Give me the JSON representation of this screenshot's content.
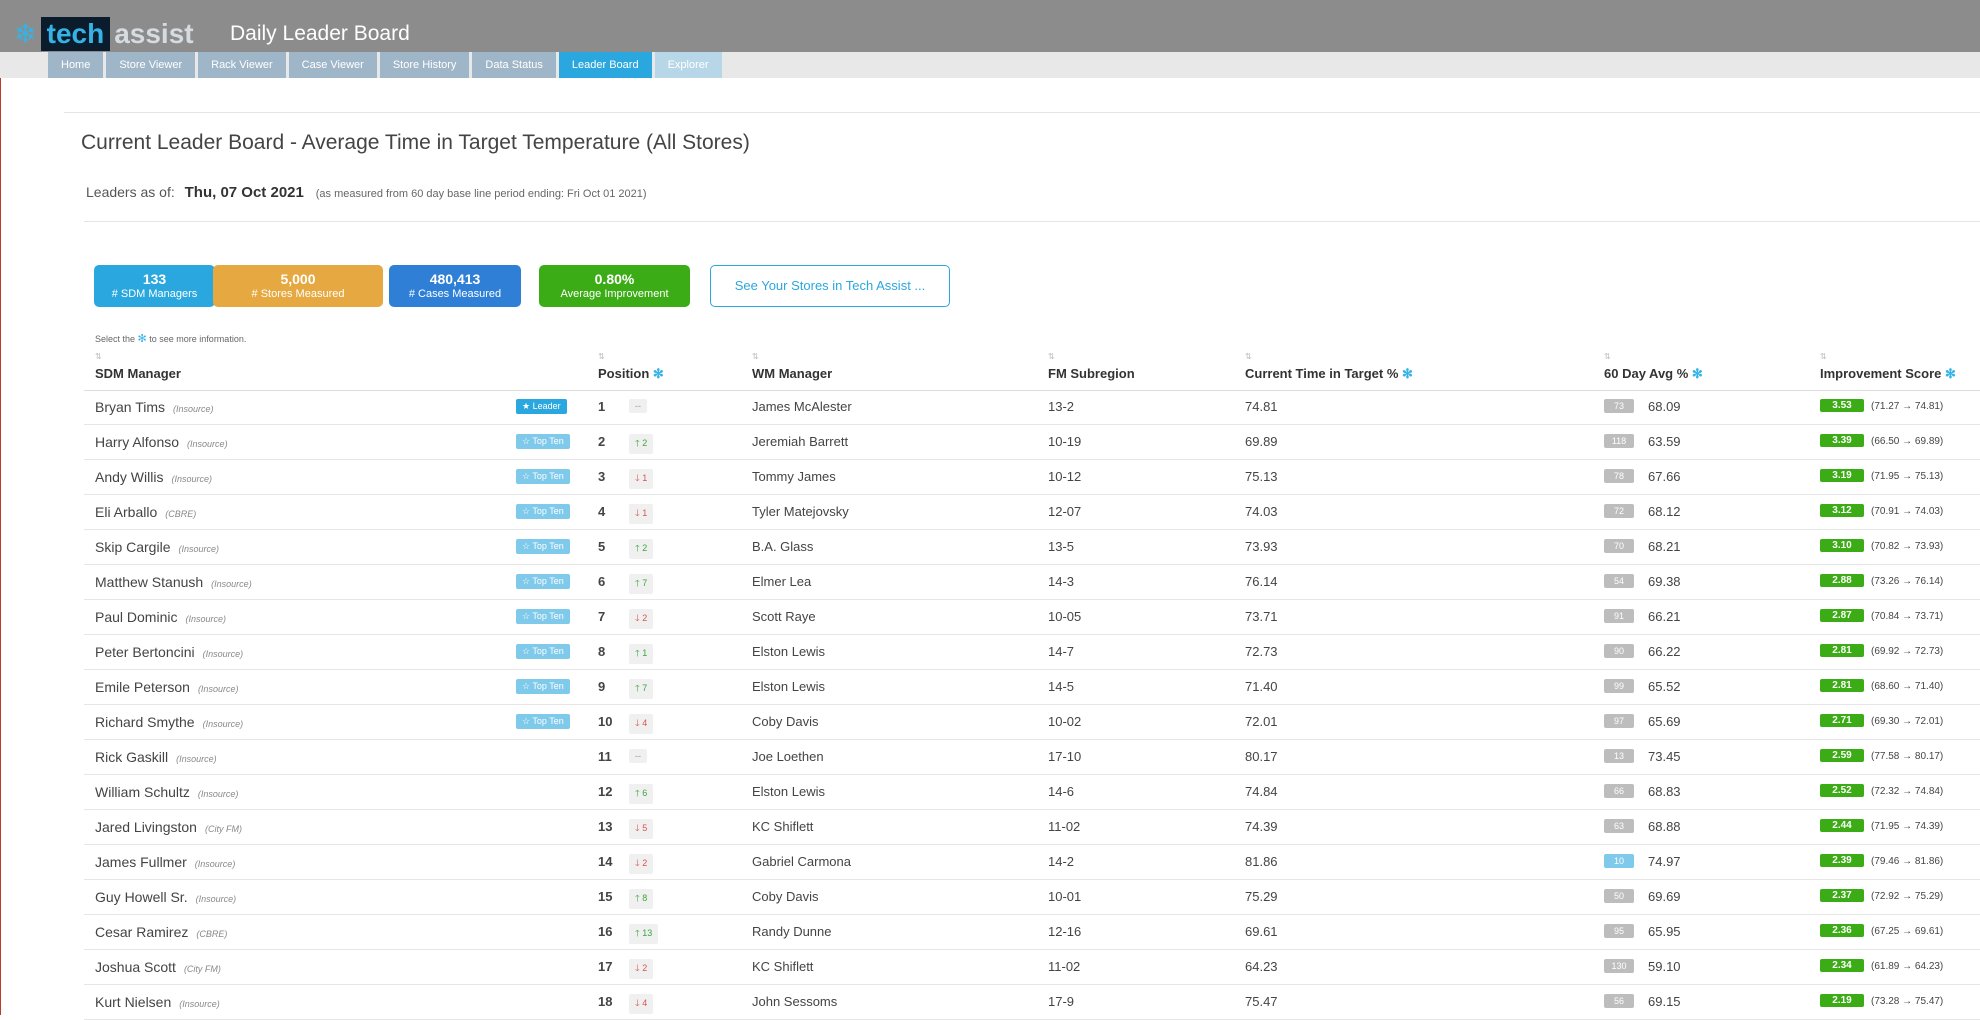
{
  "brand": {
    "tech": "tech",
    "assist": "assist"
  },
  "app_title": "Daily Leader Board",
  "tabs": [
    {
      "label": "Home"
    },
    {
      "label": "Store Viewer"
    },
    {
      "label": "Rack Viewer"
    },
    {
      "label": "Case Viewer"
    },
    {
      "label": "Store History"
    },
    {
      "label": "Data Status"
    },
    {
      "label": "Leader Board"
    },
    {
      "label": "Explorer"
    }
  ],
  "page_title": "Current Leader Board - Average Time in Target Temperature (All Stores)",
  "leaders": {
    "label": "Leaders as of:",
    "date": "Thu, 07 Oct 2021",
    "note": "(as measured from 60 day base line period ending: Fri Oct 01 2021)"
  },
  "stats": [
    {
      "value": "133",
      "label": "# SDM Managers",
      "color": "#2aa7de"
    },
    {
      "value": "5,000",
      "label": "# Stores Measured",
      "color": "#e6a840"
    },
    {
      "value": "480,413",
      "label": "# Cases Measured",
      "color": "#2f7fd6"
    },
    {
      "value": "0.80%",
      "label": "Average Improvement",
      "color": "#3cac16"
    }
  ],
  "see_button": "See Your Stores in Tech Assist ...",
  "hint": {
    "before": "Select the",
    "after": "to see more information."
  },
  "columns": {
    "sdm": "SDM Manager",
    "position": "Position",
    "wm": "WM Manager",
    "fm": "FM Subregion",
    "current": "Current Time in Target %",
    "avg": "60 Day Avg %",
    "score": "Improvement Score"
  },
  "rows": [
    {
      "name": "Bryan Tims",
      "company": "(Insource)",
      "badge": "Leader",
      "badge_type": "leader",
      "pos": "1",
      "chg": "--",
      "dir": "none",
      "wm": "James McAlester",
      "fm": "13-2",
      "current": "74.81",
      "days": "73",
      "avg": "68.09",
      "score": "3.53",
      "range": "(71.27 → 74.81)"
    },
    {
      "name": "Harry Alfonso",
      "company": "(Insource)",
      "badge": "Top Ten",
      "badge_type": "topten",
      "pos": "2",
      "chg": "2",
      "dir": "up",
      "wm": "Jeremiah Barrett",
      "fm": "10-19",
      "current": "69.89",
      "days": "118",
      "avg": "63.59",
      "score": "3.39",
      "range": "(66.50 → 69.89)"
    },
    {
      "name": "Andy Willis",
      "company": "(Insource)",
      "badge": "Top Ten",
      "badge_type": "topten",
      "pos": "3",
      "chg": "1",
      "dir": "down",
      "wm": "Tommy James",
      "fm": "10-12",
      "current": "75.13",
      "days": "78",
      "avg": "67.66",
      "score": "3.19",
      "range": "(71.95 → 75.13)"
    },
    {
      "name": "Eli Arballo",
      "company": "(CBRE)",
      "badge": "Top Ten",
      "badge_type": "topten",
      "pos": "4",
      "chg": "1",
      "dir": "down",
      "wm": "Tyler Matejovsky",
      "fm": "12-07",
      "current": "74.03",
      "days": "72",
      "avg": "68.12",
      "score": "3.12",
      "range": "(70.91 → 74.03)"
    },
    {
      "name": "Skip Cargile",
      "company": "(Insource)",
      "badge": "Top Ten",
      "badge_type": "topten",
      "pos": "5",
      "chg": "2",
      "dir": "up",
      "wm": "B.A. Glass",
      "fm": "13-5",
      "current": "73.93",
      "days": "70",
      "avg": "68.21",
      "score": "3.10",
      "range": "(70.82 → 73.93)"
    },
    {
      "name": "Matthew Stanush",
      "company": "(Insource)",
      "badge": "Top Ten",
      "badge_type": "topten",
      "pos": "6",
      "chg": "7",
      "dir": "up",
      "wm": "Elmer Lea",
      "fm": "14-3",
      "current": "76.14",
      "days": "54",
      "avg": "69.38",
      "score": "2.88",
      "range": "(73.26 → 76.14)"
    },
    {
      "name": "Paul Dominic",
      "company": "(Insource)",
      "badge": "Top Ten",
      "badge_type": "topten",
      "pos": "7",
      "chg": "2",
      "dir": "down",
      "wm": "Scott Raye",
      "fm": "10-05",
      "current": "73.71",
      "days": "91",
      "avg": "66.21",
      "score": "2.87",
      "range": "(70.84 → 73.71)"
    },
    {
      "name": "Peter Bertoncini",
      "company": "(Insource)",
      "badge": "Top Ten",
      "badge_type": "topten",
      "pos": "8",
      "chg": "1",
      "dir": "up",
      "wm": "Elston Lewis",
      "fm": "14-7",
      "current": "72.73",
      "days": "90",
      "avg": "66.22",
      "score": "2.81",
      "range": "(69.92 → 72.73)"
    },
    {
      "name": "Emile Peterson",
      "company": "(Insource)",
      "badge": "Top Ten",
      "badge_type": "topten",
      "pos": "9",
      "chg": "7",
      "dir": "up",
      "wm": "Elston Lewis",
      "fm": "14-5",
      "current": "71.40",
      "days": "99",
      "avg": "65.52",
      "score": "2.81",
      "range": "(68.60 → 71.40)"
    },
    {
      "name": "Richard Smythe",
      "company": "(Insource)",
      "badge": "Top Ten",
      "badge_type": "topten",
      "pos": "10",
      "chg": "4",
      "dir": "down",
      "wm": "Coby Davis",
      "fm": "10-02",
      "current": "72.01",
      "days": "97",
      "avg": "65.69",
      "score": "2.71",
      "range": "(69.30 → 72.01)"
    },
    {
      "name": "Rick Gaskill",
      "company": "(Insource)",
      "badge": "",
      "badge_type": "",
      "pos": "11",
      "chg": "--",
      "dir": "none",
      "wm": "Joe Loethen",
      "fm": "17-10",
      "current": "80.17",
      "days": "13",
      "avg": "73.45",
      "score": "2.59",
      "range": "(77.58 → 80.17)"
    },
    {
      "name": "William Schultz",
      "company": "(Insource)",
      "badge": "",
      "badge_type": "",
      "pos": "12",
      "chg": "6",
      "dir": "up",
      "wm": "Elston Lewis",
      "fm": "14-6",
      "current": "74.84",
      "days": "66",
      "avg": "68.83",
      "score": "2.52",
      "range": "(72.32 → 74.84)"
    },
    {
      "name": "Jared Livingston",
      "company": "(City FM)",
      "badge": "",
      "badge_type": "",
      "pos": "13",
      "chg": "5",
      "dir": "down",
      "wm": "KC Shiflett",
      "fm": "11-02",
      "current": "74.39",
      "days": "63",
      "avg": "68.88",
      "score": "2.44",
      "range": "(71.95 → 74.39)"
    },
    {
      "name": "James Fullmer",
      "company": "(Insource)",
      "badge": "",
      "badge_type": "",
      "pos": "14",
      "chg": "2",
      "dir": "down",
      "wm": "Gabriel Carmona",
      "fm": "14-2",
      "current": "81.86",
      "days": "10",
      "avg": "74.97",
      "score": "2.39",
      "range": "(79.46 → 81.86)"
    },
    {
      "name": "Guy Howell Sr.",
      "company": "(Insource)",
      "badge": "",
      "badge_type": "",
      "pos": "15",
      "chg": "8",
      "dir": "up",
      "wm": "Coby Davis",
      "fm": "10-01",
      "current": "75.29",
      "days": "50",
      "avg": "69.69",
      "score": "2.37",
      "range": "(72.92 → 75.29)"
    },
    {
      "name": "Cesar Ramirez",
      "company": "(CBRE)",
      "badge": "",
      "badge_type": "",
      "pos": "16",
      "chg": "13",
      "dir": "up",
      "wm": "Randy Dunne",
      "fm": "12-16",
      "current": "69.61",
      "days": "95",
      "avg": "65.95",
      "score": "2.36",
      "range": "(67.25 → 69.61)"
    },
    {
      "name": "Joshua Scott",
      "company": "(City FM)",
      "badge": "",
      "badge_type": "",
      "pos": "17",
      "chg": "2",
      "dir": "down",
      "wm": "KC Shiflett",
      "fm": "11-02",
      "current": "64.23",
      "days": "130",
      "avg": "59.10",
      "score": "2.34",
      "range": "(61.89 → 64.23)"
    },
    {
      "name": "Kurt Nielsen",
      "company": "(Insource)",
      "badge": "",
      "badge_type": "",
      "pos": "18",
      "chg": "4",
      "dir": "down",
      "wm": "John Sessoms",
      "fm": "17-9",
      "current": "75.47",
      "days": "56",
      "avg": "69.15",
      "score": "2.19",
      "range": "(73.28 → 75.47)"
    }
  ]
}
